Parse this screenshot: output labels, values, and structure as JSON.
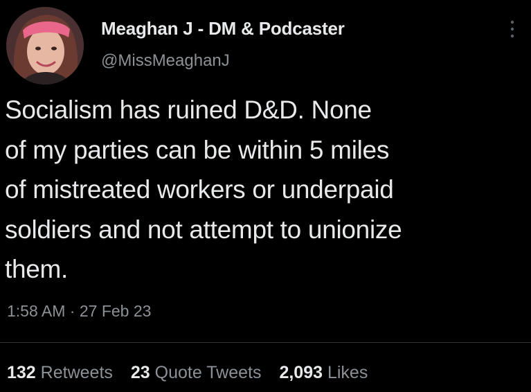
{
  "author": {
    "display_name": "Meaghan J - DM & Podcaster",
    "handle": "@MissMeaghanJ"
  },
  "tweet": {
    "lines": [
      "Socialism has ruined D&D. None",
      "of my parties can be within 5 miles",
      "of mistreated workers or underpaid",
      "soldiers and not attempt to unionize",
      "them."
    ],
    "time": "1:58 AM",
    "separator": "·",
    "date": "27 Feb 23"
  },
  "stats": {
    "retweets": {
      "count": "132",
      "label": "Retweets"
    },
    "quote_tweets": {
      "count": "23",
      "label": "Quote Tweets"
    },
    "likes": {
      "count": "2,093",
      "label": "Likes"
    }
  },
  "icons": {
    "more": "more-vertical-icon"
  },
  "colors": {
    "background": "#000000",
    "primary_text": "#e7e9ea",
    "secondary_text": "#8b9196",
    "divider": "#2f3336"
  }
}
